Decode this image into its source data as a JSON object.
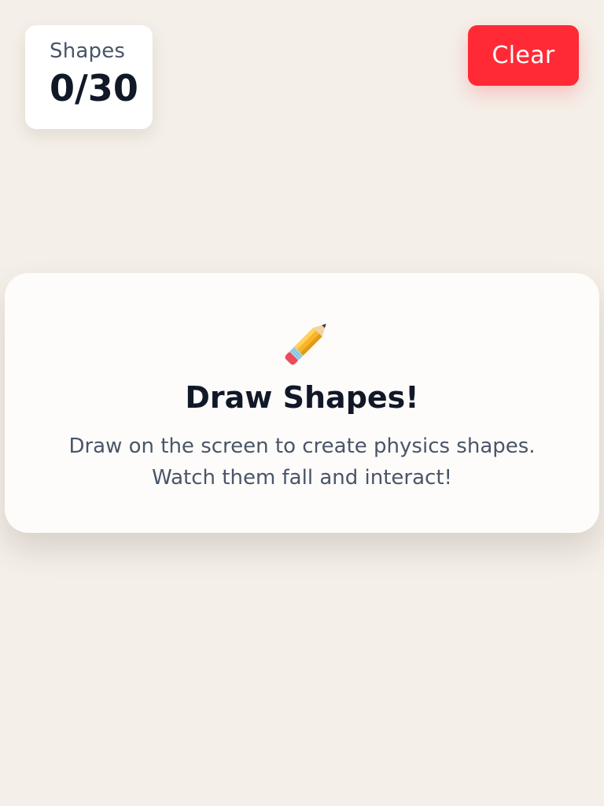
{
  "counter": {
    "label": "Shapes",
    "value": "0/30"
  },
  "toolbar": {
    "clear_label": "Clear"
  },
  "intro": {
    "icon": "pencil-icon",
    "title": "Draw Shapes!",
    "line1": "Draw on the screen to create physics shapes.",
    "line2": "Watch them fall and interact!"
  },
  "colors": {
    "background": "#f4efe8",
    "accent": "#ff2a36",
    "text_dark": "#111827",
    "text_muted": "#4a5568"
  }
}
